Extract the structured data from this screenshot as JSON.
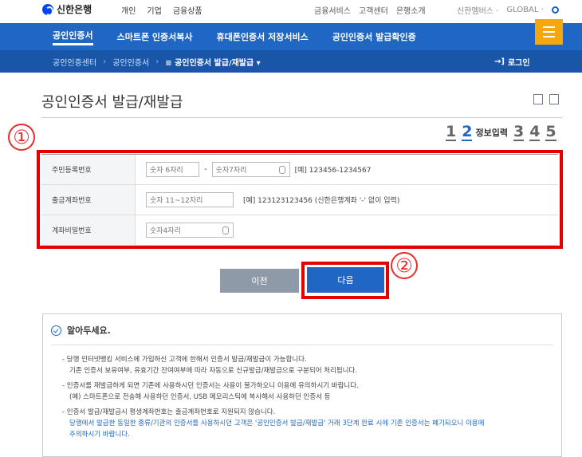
{
  "topbar": {
    "logo": "신한은행",
    "left_links": [
      "개인",
      "기업",
      "금융상품"
    ],
    "right_links": [
      "금융서비스",
      "고객센터",
      "은행소개"
    ],
    "util": [
      "신한멤버스 ·",
      "GLOBAL ·"
    ]
  },
  "mainnav": {
    "items": [
      "공인인증서",
      "스마트폰 인증서복사",
      "휴대폰인증서 저장서비스",
      "공인인증서 발급확인증"
    ]
  },
  "subnav": {
    "crumbs": [
      "공인인증센터",
      "공인인증서",
      "≡ 공인인증서 발급/재발급 ▾"
    ],
    "login": "로그인"
  },
  "page": {
    "title": "공인인증서 발급/재발급"
  },
  "steps": {
    "items": [
      "1",
      "2",
      "3",
      "4",
      "5"
    ],
    "active_label": "정보입력"
  },
  "annotations": [
    "①",
    "②"
  ],
  "form": {
    "rows": [
      {
        "label": "주민등록번호",
        "input1_placeholder": "숫자 6자리",
        "separator": "-",
        "input2_placeholder": "숫자7자리",
        "hint": "[예] 123456-1234567"
      },
      {
        "label": "출금계좌번호",
        "input_placeholder": "숫자 11~12자리",
        "hint": "[예] 123123123456 (신한은행계좌 '-' 없이 입력)"
      },
      {
        "label": "계좌비밀번호",
        "input_placeholder": "숫자4자리"
      }
    ]
  },
  "buttons": {
    "prev": "이전",
    "next": "다음"
  },
  "notice": {
    "title": "알아두세요.",
    "items": [
      {
        "lines": [
          "당행 인터넷뱅킹 서비스에 가입하신 고객에 한해서 인증서 발급/재발급이 가능합니다.",
          "기존 인증서 보유여부, 유효기간 잔여여부에 따라 자동으로 신규발급/재발급으로 구분되어 처리됩니다."
        ],
        "blue": [
          false,
          false
        ]
      },
      {
        "lines": [
          "인증서를 재발급하게 되면 기존에 사용하시던 인증서는 사용이 불가하오니 이용에 유의하시기 바랍니다.",
          "(예) 스마트폰으로 전송해 사용하던 인증서, USB 메모리스틱에 복사해서 사용하던 인증서 등"
        ],
        "blue": [
          false,
          false
        ]
      },
      {
        "lines": [
          "인증서 발급/재발급시 평생계좌번호는 출금계좌번호로 지원되지 않습니다.",
          "당행에서 발급한 동일한 종류/기관의 인증서를 사용하시던 고객은 '공인인증서 발급/재발급' 거래 3단계 완료 시에 기존 인증서는 폐기되오니 이용에",
          "주의하시기 바랍니다."
        ],
        "blue": [
          false,
          true,
          true
        ]
      }
    ]
  }
}
